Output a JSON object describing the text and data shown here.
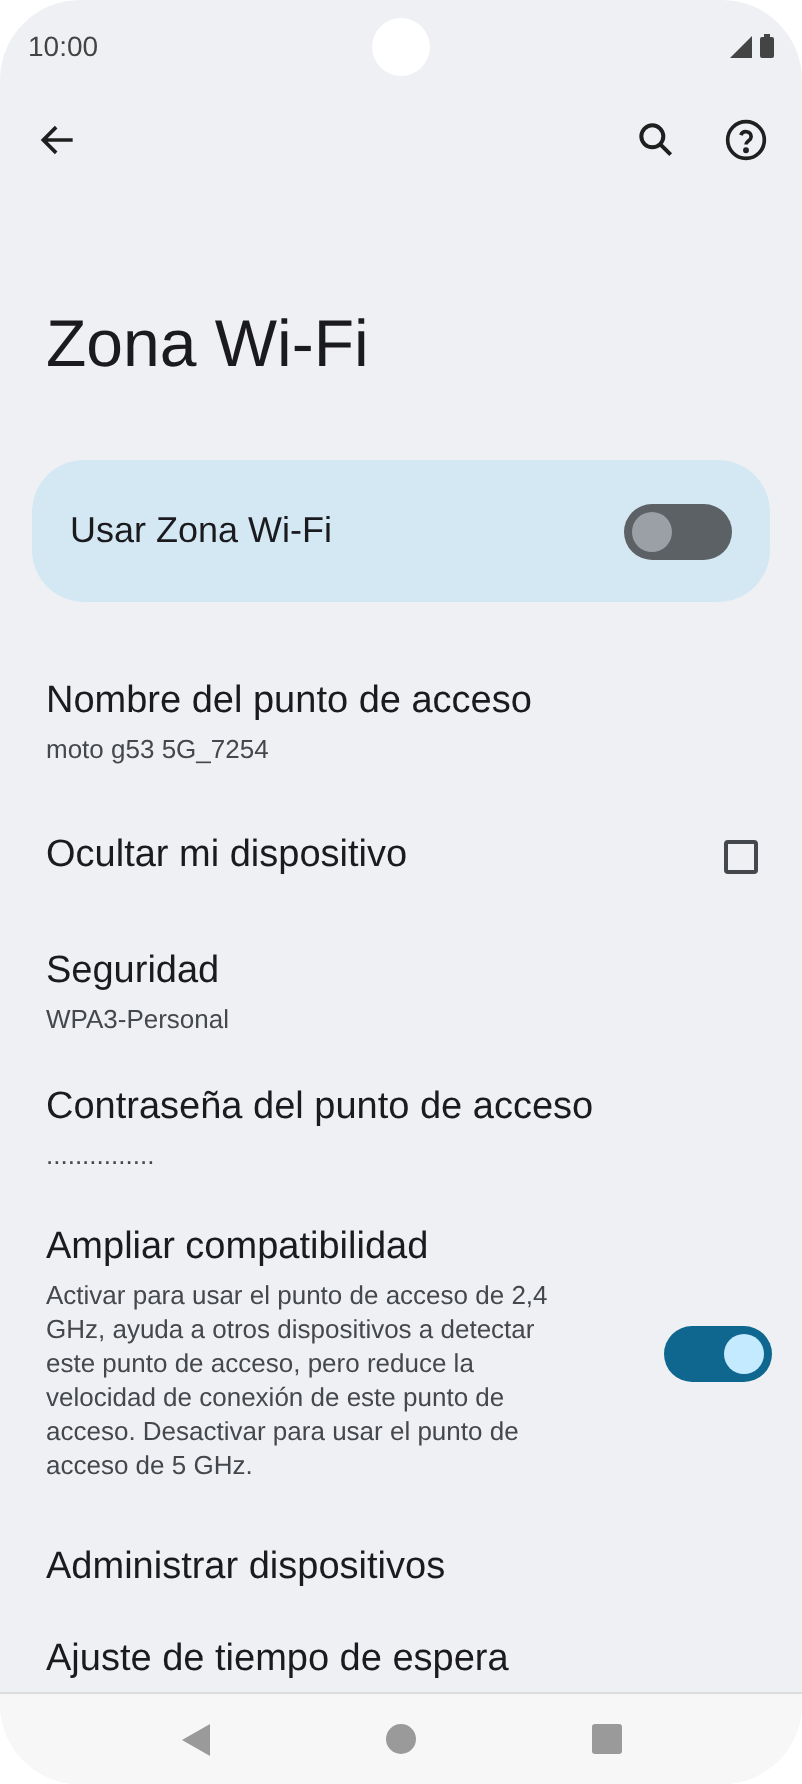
{
  "status_bar": {
    "time": "10:00"
  },
  "title": "Zona Wi-Fi",
  "main_switch": {
    "label": "Usar Zona Wi-Fi",
    "on": false
  },
  "items": [
    {
      "kind": "detail",
      "title": "Nombre del punto de acceso",
      "subtitle": "moto g53 5G_7254"
    },
    {
      "kind": "checkbox",
      "title": "Ocultar mi dispositivo",
      "checked": false
    },
    {
      "kind": "detail",
      "title": "Seguridad",
      "subtitle": "WPA3-Personal"
    },
    {
      "kind": "detail",
      "title": "Contraseña del punto de acceso",
      "subtitle": "..............."
    },
    {
      "kind": "switch",
      "title": "Ampliar compatibilidad",
      "subtitle": "Activar para usar el punto de acceso de 2,4 GHz, ayuda a otros dispositivos a detectar este punto de acceso, pero reduce la velocidad de conexión de este punto de acceso. Desactivar para usar el punto de acceso de 5 GHz.",
      "on": true
    },
    {
      "kind": "plain",
      "title": "Administrar dispositivos"
    },
    {
      "kind": "plain",
      "title": "Ajuste de tiempo de espera"
    }
  ]
}
